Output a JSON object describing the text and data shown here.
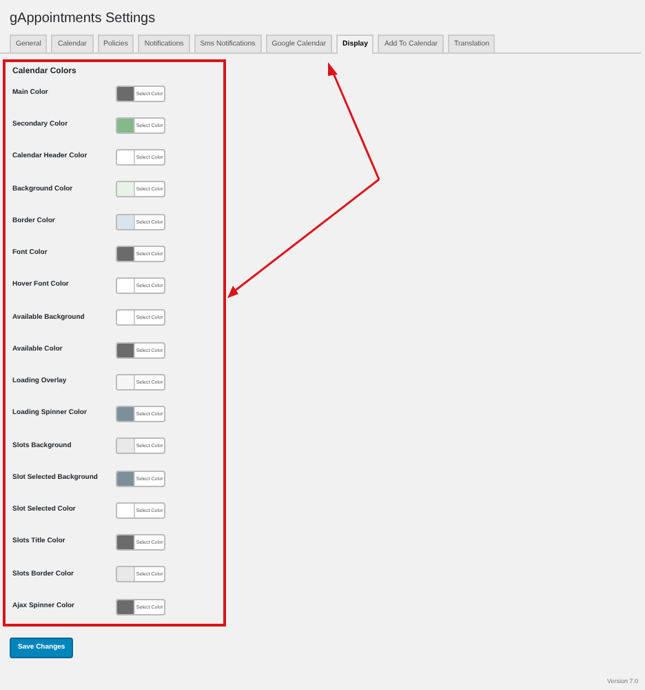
{
  "page_title": "gAppointments Settings",
  "tabs": [
    {
      "label": "General",
      "selected": false
    },
    {
      "label": "Calendar",
      "selected": false
    },
    {
      "label": "Policies",
      "selected": false
    },
    {
      "label": "Notifications",
      "selected": false
    },
    {
      "label": "Sms Notifications",
      "selected": false
    },
    {
      "label": "Google Calendar",
      "selected": false
    },
    {
      "label": "Display",
      "selected": true
    },
    {
      "label": "Add To Calendar",
      "selected": false
    },
    {
      "label": "Translation",
      "selected": false
    }
  ],
  "section_title": "Calendar Colors",
  "fields": [
    {
      "label": "Main Color",
      "color": "#6b6b6b",
      "button": "Select Color"
    },
    {
      "label": "Secondary Color",
      "color": "#86b98a",
      "button": "Select Color"
    },
    {
      "label": "Calendar Header Color",
      "color": "#ffffff",
      "button": "Select Color"
    },
    {
      "label": "Background Color",
      "color": "#e8f3e8",
      "button": "Select Color"
    },
    {
      "label": "Border Color",
      "color": "#dbe3ec",
      "button": "Select Color"
    },
    {
      "label": "Font Color",
      "color": "#6b6b6b",
      "button": "Select Color"
    },
    {
      "label": "Hover Font Color",
      "color": "#ffffff",
      "button": "Select Color"
    },
    {
      "label": "Available Background",
      "color": "#ffffff",
      "button": "Select Color"
    },
    {
      "label": "Available Color",
      "color": "#6b6b6b",
      "button": "Select Color"
    },
    {
      "label": "Loading Overlay",
      "color": "#f6f6f6",
      "button": "Select Color"
    },
    {
      "label": "Loading Spinner Color",
      "color": "#7b909a",
      "button": "Select Color"
    },
    {
      "label": "Slots Background",
      "color": "#e9e9e9",
      "button": "Select Color"
    },
    {
      "label": "Slot Selected Background",
      "color": "#7b909a",
      "button": "Select Color"
    },
    {
      "label": "Slot Selected Color",
      "color": "#ffffff",
      "button": "Select Color"
    },
    {
      "label": "Slots Title Color",
      "color": "#6b6b6b",
      "button": "Select Color"
    },
    {
      "label": "Slots Border Color",
      "color": "#e9e9e9",
      "button": "Select Color"
    },
    {
      "label": "Ajax Spinner Color",
      "color": "#6b6b6b",
      "button": "Select Color"
    }
  ],
  "save_button": "Save Changes",
  "version": "Version 7.0"
}
